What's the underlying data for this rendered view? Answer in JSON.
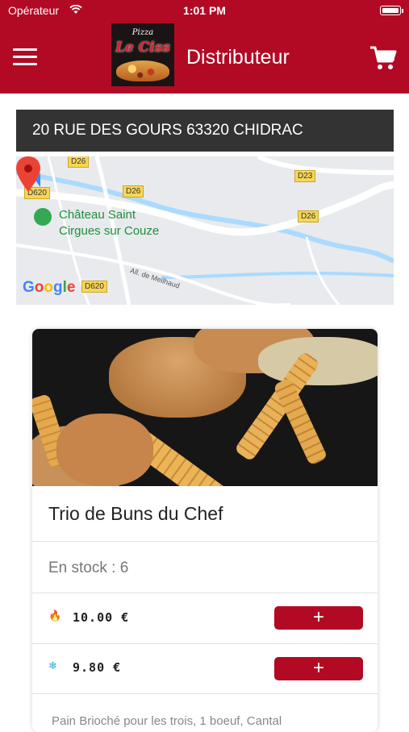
{
  "status_bar": {
    "carrier": "Opérateur",
    "time": "1:01 PM"
  },
  "header": {
    "logo_line1": "Pizza",
    "logo_line2": "Le Ciss",
    "title": "Distributeur"
  },
  "address": "20 RUE DES GOURS 63320 CHIDRAC",
  "map": {
    "road_labels": [
      "D26",
      "D620",
      "D26",
      "D23",
      "D26",
      "D620"
    ],
    "poi_line1": "Château Saint",
    "poi_line2": "Cirgues sur Couze",
    "small_road": "All. de Meilhaud",
    "google": "Google"
  },
  "product": {
    "name": "Trio de Buns du Chef",
    "stock": "En stock : 6",
    "prices": [
      {
        "icon": "fire-icon",
        "glyph": "🔥",
        "value": "10.00 €"
      },
      {
        "icon": "snowflake-icon",
        "glyph": "❄",
        "value": "9.80 €"
      }
    ],
    "add_label": "+",
    "description": "Pain Brioché pour les trois, 1 boeuf, Cantal"
  },
  "colors": {
    "brand": "#b20a24",
    "address_bg": "#333333",
    "map_bg": "#e8eaed"
  }
}
